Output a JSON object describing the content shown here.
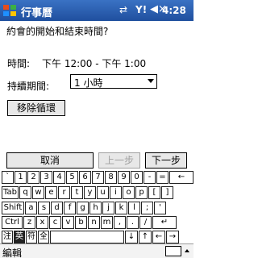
{
  "titlebar": {
    "title": "行事曆",
    "clock": "4:28",
    "start_icon": "windows-flag-icon",
    "connectivity_icon": "connectivity-icon",
    "signal_icon": "signal-icon",
    "volume_icon": "speaker-muted-icon",
    "connectivity_glyph": "⇄",
    "signal_glyph": "Y!",
    "volume_glyph": "◀×"
  },
  "content": {
    "prompt": "約會的開始和結束時間?",
    "time_label": "時間:",
    "time_value": "下午 12:00 - 下午 1:00",
    "duration_label": "持續期間:",
    "duration_value": "1 小時",
    "remove_recurrence": "移除循環"
  },
  "buttons": {
    "cancel": "取消",
    "prev": "上一步",
    "next": "下一步"
  },
  "keyboard": {
    "rows": [
      [
        "`",
        "1",
        "2",
        "3",
        "4",
        "5",
        "6",
        "7",
        "8",
        "9",
        "0",
        "-",
        "=",
        "←"
      ],
      [
        "Tab",
        "q",
        "w",
        "e",
        "r",
        "t",
        "y",
        "u",
        "i",
        "o",
        "p",
        "[",
        "]"
      ],
      [
        "Shift",
        "a",
        "s",
        "d",
        "f",
        "g",
        "h",
        "j",
        "k",
        "l",
        ";",
        "'"
      ],
      [
        "Ctrl",
        "z",
        "x",
        "c",
        "v",
        "b",
        "n",
        "m",
        ",",
        ".",
        "/",
        "↵"
      ],
      [
        "注",
        "英",
        "符",
        "全",
        "",
        "↓",
        "↑",
        "←",
        "→"
      ]
    ]
  },
  "menubar": {
    "edit": "編輯"
  },
  "colors": {
    "titlebar": "#1f4f9e",
    "disabled_text": "#a0a0a0"
  }
}
